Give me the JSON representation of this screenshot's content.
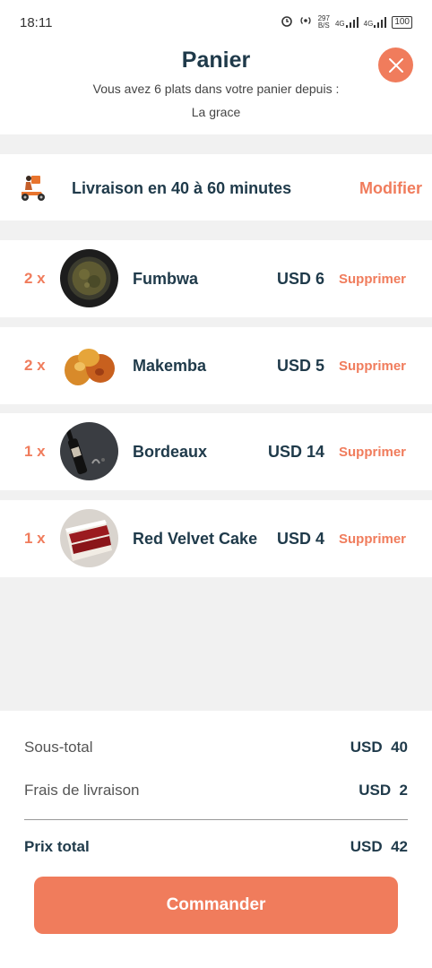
{
  "status_bar": {
    "time": "18:11",
    "speed_value": "297",
    "speed_unit": "B/S",
    "network_1": "4G",
    "network_2": "4G",
    "battery": "100"
  },
  "header": {
    "title": "Panier",
    "subtitle": "Vous avez 6 plats dans votre panier depuis :",
    "location": "La grace",
    "close_icon": "close-icon"
  },
  "delivery": {
    "label": "Livraison en 40 à 60 minutes",
    "modify_label": "Modifier",
    "icon": "delivery-scooter-icon"
  },
  "cart": {
    "delete_label": "Supprimer",
    "items": [
      {
        "qty": "2 x",
        "name": "Fumbwa",
        "price": "USD 6"
      },
      {
        "qty": "2 x",
        "name": "Makemba",
        "price": "USD 5"
      },
      {
        "qty": "1 x",
        "name": "Bordeaux",
        "price": "USD 14"
      },
      {
        "qty": "1 x",
        "name": "Red Velvet Cake",
        "price": "USD 4"
      }
    ]
  },
  "summary": {
    "subtotal_label": "Sous-total",
    "subtotal_value": "USD  40",
    "delivery_fee_label": "Frais de livraison",
    "delivery_fee_value": "USD  2",
    "total_label": "Prix total",
    "total_value": "USD  42",
    "order_button": "Commander"
  },
  "colors": {
    "accent": "#f07c5c",
    "text_dark": "#1f3a4a",
    "background": "#f1f1f1"
  }
}
